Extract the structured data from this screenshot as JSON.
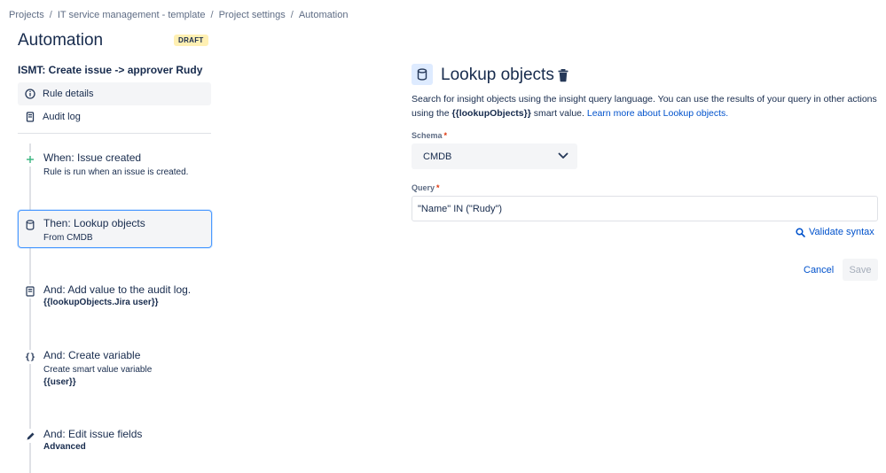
{
  "breadcrumb": [
    "Projects",
    "IT service management - template",
    "Project settings",
    "Automation"
  ],
  "page_title": "Automation",
  "draft_badge": "DRAFT",
  "rule_name": "ISMT: Create issue -> approver Rudy",
  "nav": {
    "rule_details": "Rule details",
    "audit_log": "Audit log"
  },
  "steps": [
    {
      "icon": "plus-icon",
      "title": "When: Issue created",
      "sub": "Rule is run when an issue is created.",
      "bold": ""
    },
    {
      "icon": "database-icon",
      "title": "Then: Lookup objects",
      "sub": "From CMDB",
      "bold": ""
    },
    {
      "icon": "document-icon",
      "title": "And: Add value to the audit log.",
      "sub": "",
      "bold": "{{lookupObjects.Jira user}}"
    },
    {
      "icon": "braces-icon",
      "title": "And: Create variable",
      "sub": "Create smart value variable",
      "bold": "{{user}}"
    },
    {
      "icon": "pencil-icon",
      "title": "And: Edit issue fields",
      "sub": "",
      "bold": "Advanced"
    }
  ],
  "panel": {
    "title": "Lookup objects",
    "desc_part1": "Search for insight objects using the insight query language. You can use the results of your query in other actions using the ",
    "desc_smart": "{{lookupObjects}}",
    "desc_part2": " smart value. ",
    "desc_link": "Learn more about Lookup objects.",
    "schema_label": "Schema",
    "schema_value": "CMDB",
    "query_label": "Query",
    "query_value": "\"Name\" IN (\"Rudy\")",
    "required_mark": "*",
    "validate_label": "Validate syntax",
    "cancel_label": "Cancel",
    "save_label": "Save"
  },
  "colors": {
    "accent": "#0052cc",
    "selected_border": "#4c9aff",
    "draft_bg": "#fff0b3",
    "required": "#de350b"
  }
}
